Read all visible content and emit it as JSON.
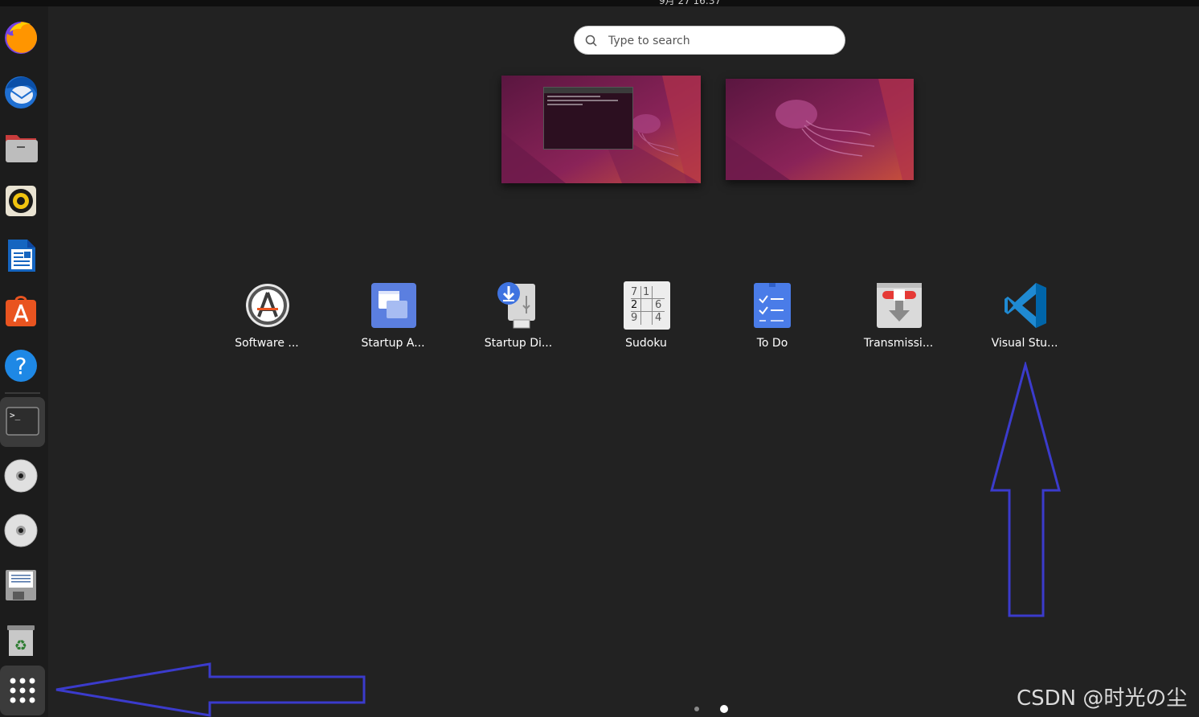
{
  "topbar": {
    "clock": "9月 27 16:37"
  },
  "search": {
    "placeholder": "Type to search"
  },
  "dock": {
    "items": [
      {
        "name": "Firefox"
      },
      {
        "name": "Thunderbird"
      },
      {
        "name": "Files"
      },
      {
        "name": "Rhythmbox"
      },
      {
        "name": "LibreOffice Writer"
      },
      {
        "name": "Ubuntu Software"
      },
      {
        "name": "Help"
      },
      {
        "name": "Terminal"
      },
      {
        "name": "Disc 1"
      },
      {
        "name": "Disc 2"
      },
      {
        "name": "Floppy"
      },
      {
        "name": "Trash"
      },
      {
        "name": "Show Applications"
      }
    ]
  },
  "apps": [
    {
      "label": "Software ..."
    },
    {
      "label": "Startup A..."
    },
    {
      "label": "Startup Di..."
    },
    {
      "label": "Sudoku",
      "cells": [
        "7",
        "1",
        "2",
        "6",
        "9",
        "4"
      ]
    },
    {
      "label": "To Do"
    },
    {
      "label": "Transmissi..."
    },
    {
      "label": "Visual Stu..."
    }
  ],
  "pages": {
    "count": 2,
    "current": 2
  },
  "watermark": "CSDN @时光の尘",
  "colors": {
    "arrow": "#3b3bcc",
    "dock_active": "#3b3b3b",
    "background": "#222222"
  }
}
